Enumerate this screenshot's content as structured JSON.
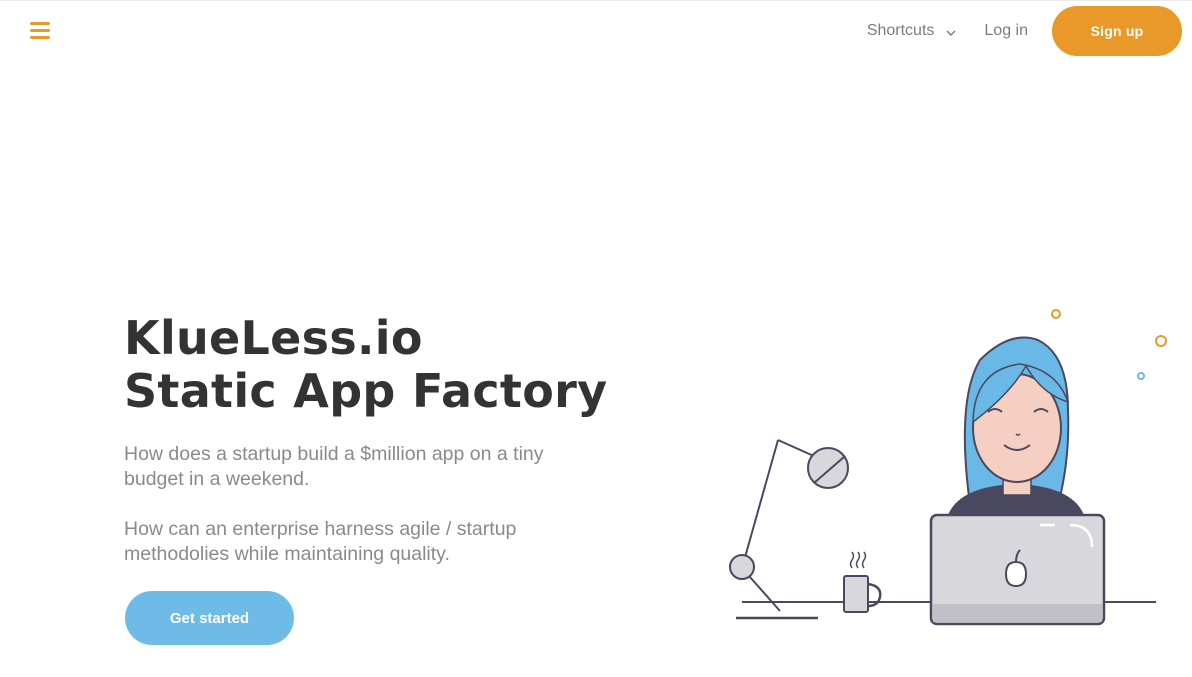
{
  "nav": {
    "shortcuts_label": "Shortcuts",
    "login_label": "Log in",
    "signup_label": "Sign up"
  },
  "hero": {
    "title_line1": "KlueLess.io",
    "title_line2": "Static App Factory",
    "paragraph1": "How does a startup build a $million app on a tiny budget in a weekend.",
    "paragraph2": "How can an enterprise harness agile / startup methodolies while maintaining quality.",
    "cta_label": "Get started"
  },
  "colors": {
    "accent": "#e8992a",
    "cta_blue": "#6fbbe8",
    "hair_blue": "#6ab8e6",
    "ink": "#4a4860"
  },
  "icons": {
    "menu": "hamburger-icon",
    "shortcuts": "chevron-down-icon",
    "laptop_logo": "apple-icon"
  }
}
